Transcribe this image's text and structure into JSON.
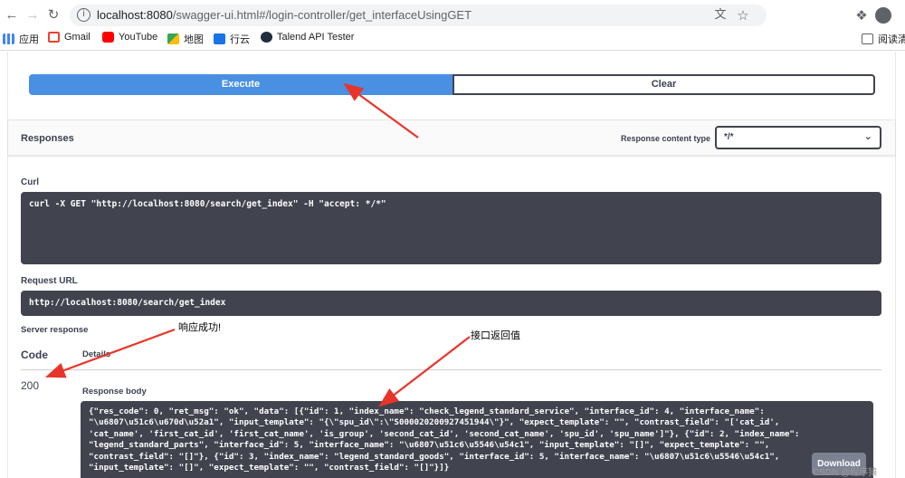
{
  "browser": {
    "url_host": "localhost:8080",
    "url_path": "/swagger-ui.html#/login-controller/get_interfaceUsingGET",
    "bookmarks": [
      {
        "label": "应用",
        "icon": "apps-grid-icon",
        "color": "#4285f4"
      },
      {
        "label": "Gmail",
        "icon": "gmail-icon",
        "color": "#ea4335"
      },
      {
        "label": "YouTube",
        "icon": "youtube-icon",
        "color": "#ff0000"
      },
      {
        "label": "地图",
        "icon": "maps-icon",
        "color": "#34a853"
      },
      {
        "label": "行云",
        "icon": "xingyun-icon",
        "color": "#1a73e8"
      },
      {
        "label": "Talend API Tester",
        "icon": "talend-icon",
        "color": "#1f2d3d"
      }
    ],
    "reading_list": "阅读清"
  },
  "swagger": {
    "execute_label": "Execute",
    "clear_label": "Clear",
    "responses_title": "Responses",
    "content_type_label": "Response content type",
    "content_type_value": "*/*",
    "curl_label": "Curl",
    "curl_command": "curl -X GET \"http://localhost:8080/search/get_index\" -H \"accept: */*\"",
    "request_url_label": "Request URL",
    "request_url": "http://localhost:8080/search/get_index",
    "server_response_label": "Server response",
    "code_header": "Code",
    "details_header": "Details",
    "status_code": "200",
    "response_body_label": "Response body",
    "response_body_lines": [
      "{\"res_code\": 0, \"ret_msg\": \"ok\", \"data\": [{\"id\": 1, \"index_name\": \"check_legend_standard_service\", \"interface_id\": 4, \"interface_name\":",
      "\"\\u6807\\u51c6\\u670d\\u52a1\", \"input_template\": \"{\\\"spu_id\\\":\\\"S000020200927451944\\\"}\", \"expect_template\": \"\", \"contrast_field\": \"['cat_id',",
      "'cat_name', 'first_cat_id', 'first_cat_name', 'is_group', 'second_cat_id', 'second_cat_name', 'spu_id', 'spu_name']\"}, {\"id\": 2, \"index_name\":",
      "\"legend_standard_parts\", \"interface_id\": 5, \"interface_name\": \"\\u6807\\u51c6\\u5546\\u54c1\", \"input_template\": \"[]\", \"expect_template\": \"\",",
      "\"contrast_field\": \"[]\"}, {\"id\": 3, \"index_name\": \"legend_standard_goods\", \"interface_id\": 5, \"interface_name\": \"\\u6807\\u51c6\\u5546\\u54c1\",",
      "\"input_template\": \"[]\", \"expect_template\": \"\", \"contrast_field\": \"[]\"}]}"
    ],
    "download_label": "Download"
  },
  "annotations": {
    "success_note": "响应成功!",
    "return_note": "接口返回值",
    "arrow_color": "#e8352b"
  },
  "watermark": "CSDN @程序猿"
}
